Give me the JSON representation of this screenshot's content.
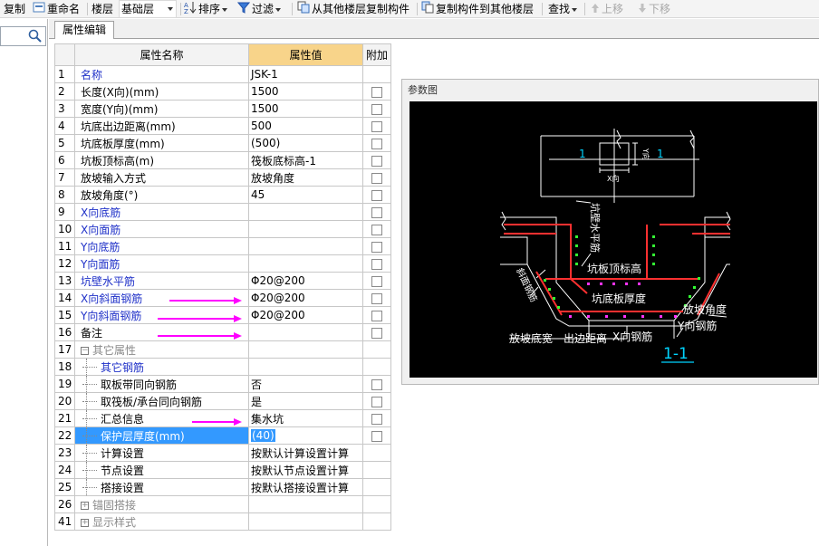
{
  "toolbar": {
    "copy": "复制",
    "rename": "重命名",
    "floor_label": "楼层",
    "floor_value": "基础层",
    "sort": "排序",
    "filter": "过滤",
    "copy_from_other": "从其他楼层复制构件",
    "copy_to_other": "复制构件到其他楼层",
    "find": "查找",
    "move_up": "上移",
    "move_down": "下移"
  },
  "tab": {
    "label": "属性编辑"
  },
  "table": {
    "headers": {
      "name": "属性名称",
      "value": "属性值",
      "add": "附加"
    },
    "rows": [
      {
        "num": "1",
        "name": "名称",
        "value": "JSK-1"
      },
      {
        "num": "2",
        "name": "长度(X向)(mm)",
        "value": "1500"
      },
      {
        "num": "3",
        "name": "宽度(Y向)(mm)",
        "value": "1500"
      },
      {
        "num": "4",
        "name": "坑底出边距离(mm)",
        "value": "500"
      },
      {
        "num": "5",
        "name": "坑底板厚度(mm)",
        "value": "(500)"
      },
      {
        "num": "6",
        "name": "坑板顶标高(m)",
        "value": "筏板底标高-1"
      },
      {
        "num": "7",
        "name": "放坡输入方式",
        "value": "放坡角度"
      },
      {
        "num": "8",
        "name": "放坡角度(°)",
        "value": "45"
      },
      {
        "num": "9",
        "name": "X向底筋",
        "value": ""
      },
      {
        "num": "10",
        "name": "X向面筋",
        "value": ""
      },
      {
        "num": "11",
        "name": "Y向底筋",
        "value": ""
      },
      {
        "num": "12",
        "name": "Y向面筋",
        "value": ""
      },
      {
        "num": "13",
        "name": "坑壁水平筋",
        "value": "Φ20@200"
      },
      {
        "num": "14",
        "name": "X向斜面钢筋",
        "value": "Φ20@200"
      },
      {
        "num": "15",
        "name": "Y向斜面钢筋",
        "value": "Φ20@200"
      },
      {
        "num": "16",
        "name": "备注",
        "value": ""
      },
      {
        "num": "17",
        "name": "其它属性",
        "value": "",
        "expander": "−"
      },
      {
        "num": "18",
        "name": "其它钢筋",
        "value": ""
      },
      {
        "num": "19",
        "name": "取板带同向钢筋",
        "value": "否"
      },
      {
        "num": "20",
        "name": "取筏板/承台同向钢筋",
        "value": "是"
      },
      {
        "num": "21",
        "name": "汇总信息",
        "value": "集水坑"
      },
      {
        "num": "22",
        "name": "保护层厚度(mm)",
        "value": "(40)"
      },
      {
        "num": "23",
        "name": "计算设置",
        "value": "按默认计算设置计算"
      },
      {
        "num": "24",
        "name": "节点设置",
        "value": "按默认节点设置计算"
      },
      {
        "num": "25",
        "name": "搭接设置",
        "value": "按默认搭接设置计算"
      },
      {
        "num": "26",
        "name": "锚固搭接",
        "value": "",
        "expander": "+"
      },
      {
        "num": "41",
        "name": "显示样式",
        "value": "",
        "expander": "+"
      }
    ]
  },
  "param_panel": {
    "title": "参数图",
    "labels": {
      "sec_left": "1",
      "sec_right": "1",
      "y_dir": "Y向",
      "x_dir": "X向",
      "wall_horiz": "坑壁水平筋",
      "top_elev": "坑板顶标高",
      "slope_rebar": "斜面钢筋",
      "bottom_thick": "坑底板厚度",
      "slope_angle": "放坡角度",
      "y_rebar": "Y向钢筋",
      "slope_width": "放坡底宽",
      "out_dist": "出边距离",
      "x_rebar": "X向钢筋",
      "section": "1-1"
    }
  },
  "colors": {
    "arrow": "#ff00ff",
    "blue_text": "#1f30c8",
    "selection": "#3399ff",
    "value_header": "#f8d48a"
  }
}
